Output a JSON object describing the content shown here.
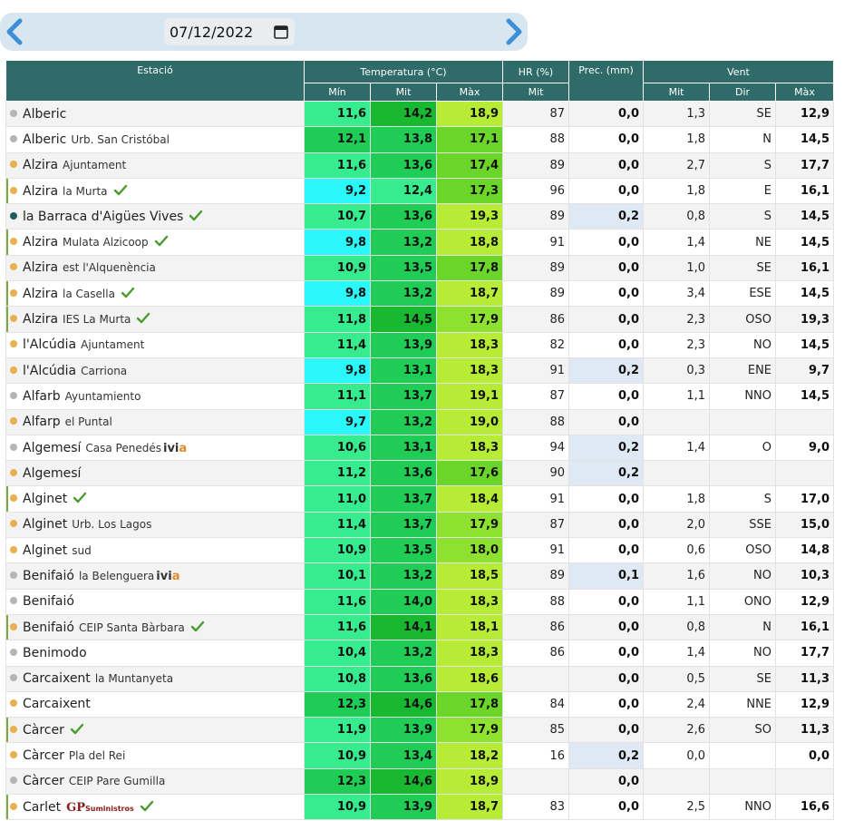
{
  "date": "07/12/2022",
  "headers": {
    "estacio": "Estació",
    "temperatura": "Temperatura (°C)",
    "hr": "HR (%)",
    "prec": "Prec. (mm)",
    "vent": "Vent",
    "min": "Mín",
    "mit": "Mit",
    "max": "Màx",
    "hr_mit": "Mit",
    "vent_mit": "Mit",
    "dir": "Dir",
    "vent_max": "Màx"
  },
  "colors": {
    "header_bg": "#2f6b68",
    "dot_grey": "#b5b5b5",
    "dot_orange": "#e8b04e",
    "dot_teal": "#1f5e5c",
    "check_green": "#4a9a2e",
    "cyan": "#2af7f7",
    "green_light": "#36ec8e",
    "green_mid": "#1fcc55",
    "green_dark": "#19b831",
    "lime": "#b6ec35",
    "lime2": "#8ee031",
    "lime3": "#6cd529"
  },
  "rows": [
    {
      "name": "Alberic",
      "sub": "",
      "dot": "grey",
      "check": false,
      "mark": false,
      "min": "11,6",
      "mit": "14,2",
      "max": "18,9",
      "hr": "87",
      "prec": "0,0",
      "wet": false,
      "vmit": "1,3",
      "dir": "SE",
      "vmax": "12,9",
      "cmin": "green_light",
      "cmit": "green_dark",
      "cmax": "lime"
    },
    {
      "name": "Alberic",
      "sub": "Urb. San Cristóbal",
      "dot": "grey",
      "check": false,
      "mark": false,
      "min": "12,1",
      "mit": "13,8",
      "max": "17,1",
      "hr": "88",
      "prec": "0,0",
      "wet": false,
      "vmit": "1,8",
      "dir": "N",
      "vmax": "14,5",
      "cmin": "green_mid",
      "cmit": "green_mid",
      "cmax": "lime3"
    },
    {
      "name": "Alzira",
      "sub": "Ajuntament",
      "dot": "orange",
      "check": false,
      "mark": false,
      "min": "11,6",
      "mit": "13,6",
      "max": "17,4",
      "hr": "89",
      "prec": "0,0",
      "wet": false,
      "vmit": "2,7",
      "dir": "S",
      "vmax": "17,7",
      "cmin": "green_light",
      "cmit": "green_mid",
      "cmax": "lime3"
    },
    {
      "name": "Alzira",
      "sub": "la Murta",
      "dot": "orange",
      "check": true,
      "mark": true,
      "min": "9,2",
      "mit": "12,4",
      "max": "17,3",
      "hr": "96",
      "prec": "0,0",
      "wet": false,
      "vmit": "1,8",
      "dir": "E",
      "vmax": "16,1",
      "cmin": "cyan",
      "cmit": "green_light",
      "cmax": "lime3"
    },
    {
      "name": "la Barraca d'Aigües Vives",
      "sub": "",
      "dot": "teal",
      "check": true,
      "mark": false,
      "min": "10,7",
      "mit": "13,6",
      "max": "19,3",
      "hr": "89",
      "prec": "0,2",
      "wet": true,
      "vmit": "0,8",
      "dir": "S",
      "vmax": "14,5",
      "cmin": "green_light",
      "cmit": "green_mid",
      "cmax": "lime"
    },
    {
      "name": "Alzira",
      "sub": "Mulata Alzicoop",
      "dot": "orange",
      "check": true,
      "mark": true,
      "min": "9,8",
      "mit": "13,2",
      "max": "18,8",
      "hr": "91",
      "prec": "0,0",
      "wet": false,
      "vmit": "1,4",
      "dir": "NE",
      "vmax": "14,5",
      "cmin": "cyan",
      "cmit": "green_mid",
      "cmax": "lime"
    },
    {
      "name": "Alzira",
      "sub": "est l'Alquenència",
      "dot": "orange",
      "check": false,
      "mark": false,
      "min": "10,9",
      "mit": "13,5",
      "max": "17,8",
      "hr": "89",
      "prec": "0,0",
      "wet": false,
      "vmit": "1,0",
      "dir": "SE",
      "vmax": "16,1",
      "cmin": "green_light",
      "cmit": "green_mid",
      "cmax": "lime3"
    },
    {
      "name": "Alzira",
      "sub": "la Casella",
      "dot": "orange",
      "check": true,
      "mark": true,
      "min": "9,8",
      "mit": "13,2",
      "max": "18,7",
      "hr": "89",
      "prec": "0,0",
      "wet": false,
      "vmit": "3,4",
      "dir": "ESE",
      "vmax": "14,5",
      "cmin": "cyan",
      "cmit": "green_mid",
      "cmax": "lime"
    },
    {
      "name": "Alzira",
      "sub": "IES La Murta",
      "dot": "orange",
      "check": true,
      "mark": true,
      "min": "11,8",
      "mit": "14,5",
      "max": "17,9",
      "hr": "86",
      "prec": "0,0",
      "wet": false,
      "vmit": "2,3",
      "dir": "OSO",
      "vmax": "19,3",
      "cmin": "green_light",
      "cmit": "green_dark",
      "cmax": "lime2"
    },
    {
      "name": "l'Alcúdia",
      "sub": "Ajuntament",
      "dot": "orange",
      "check": false,
      "mark": false,
      "min": "11,4",
      "mit": "13,9",
      "max": "18,3",
      "hr": "82",
      "prec": "0,0",
      "wet": false,
      "vmit": "2,3",
      "dir": "NO",
      "vmax": "14,5",
      "cmin": "green_light",
      "cmit": "green_mid",
      "cmax": "lime"
    },
    {
      "name": "l'Alcúdia",
      "sub": "Carriona",
      "dot": "orange",
      "check": false,
      "mark": false,
      "min": "9,8",
      "mit": "13,1",
      "max": "18,3",
      "hr": "91",
      "prec": "0,2",
      "wet": true,
      "vmit": "0,3",
      "dir": "ENE",
      "vmax": "9,7",
      "cmin": "cyan",
      "cmit": "green_mid",
      "cmax": "lime"
    },
    {
      "name": "Alfarb",
      "sub": "Ayuntamiento",
      "dot": "grey",
      "check": false,
      "mark": false,
      "min": "11,1",
      "mit": "13,7",
      "max": "19,1",
      "hr": "87",
      "prec": "0,0",
      "wet": false,
      "vmit": "1,1",
      "dir": "NNO",
      "vmax": "14,5",
      "cmin": "green_light",
      "cmit": "green_mid",
      "cmax": "lime"
    },
    {
      "name": "Alfarp",
      "sub": "el Puntal",
      "dot": "orange",
      "check": false,
      "mark": false,
      "min": "9,7",
      "mit": "13,2",
      "max": "19,0",
      "hr": "88",
      "prec": "0,0",
      "wet": false,
      "vmit": "",
      "dir": "",
      "vmax": "",
      "cmin": "cyan",
      "cmit": "green_mid",
      "cmax": "lime"
    },
    {
      "name": "Algemesí",
      "sub": "Casa Penedés",
      "logo": "ivia",
      "dot": "grey",
      "check": false,
      "mark": false,
      "min": "10,6",
      "mit": "13,1",
      "max": "18,3",
      "hr": "94",
      "prec": "0,2",
      "wet": true,
      "vmit": "1,4",
      "dir": "O",
      "vmax": "9,0",
      "cmin": "green_light",
      "cmit": "green_mid",
      "cmax": "lime"
    },
    {
      "name": "Algemesí",
      "sub": "",
      "dot": "orange",
      "check": false,
      "mark": false,
      "min": "11,2",
      "mit": "13,6",
      "max": "17,6",
      "hr": "90",
      "prec": "0,2",
      "wet": true,
      "vmit": "",
      "dir": "",
      "vmax": "",
      "cmin": "green_light",
      "cmit": "green_mid",
      "cmax": "lime3"
    },
    {
      "name": "Alginet",
      "sub": "",
      "dot": "orange",
      "check": true,
      "mark": true,
      "min": "11,0",
      "mit": "13,7",
      "max": "18,4",
      "hr": "91",
      "prec": "0,0",
      "wet": false,
      "vmit": "1,8",
      "dir": "S",
      "vmax": "17,0",
      "cmin": "green_light",
      "cmit": "green_mid",
      "cmax": "lime"
    },
    {
      "name": "Alginet",
      "sub": "Urb. Los Lagos",
      "dot": "orange",
      "check": false,
      "mark": false,
      "min": "11,4",
      "mit": "13,7",
      "max": "17,9",
      "hr": "87",
      "prec": "0,0",
      "wet": false,
      "vmit": "2,0",
      "dir": "SSE",
      "vmax": "15,0",
      "cmin": "green_light",
      "cmit": "green_mid",
      "cmax": "lime2"
    },
    {
      "name": "Alginet",
      "sub": "sud",
      "dot": "orange",
      "check": false,
      "mark": false,
      "min": "10,9",
      "mit": "13,5",
      "max": "18,0",
      "hr": "91",
      "prec": "0,0",
      "wet": false,
      "vmit": "0,6",
      "dir": "OSO",
      "vmax": "14,8",
      "cmin": "green_light",
      "cmit": "green_mid",
      "cmax": "lime2"
    },
    {
      "name": "Benifaió",
      "sub": "la Belenguera",
      "logo": "ivia",
      "dot": "grey",
      "check": false,
      "mark": false,
      "min": "10,1",
      "mit": "13,2",
      "max": "18,5",
      "hr": "89",
      "prec": "0,1",
      "wet": true,
      "vmit": "1,6",
      "dir": "NO",
      "vmax": "10,3",
      "cmin": "green_light",
      "cmit": "green_mid",
      "cmax": "lime"
    },
    {
      "name": "Benifaió",
      "sub": "",
      "dot": "grey",
      "check": false,
      "mark": false,
      "min": "11,6",
      "mit": "14,0",
      "max": "18,3",
      "hr": "88",
      "prec": "0,0",
      "wet": false,
      "vmit": "1,1",
      "dir": "ONO",
      "vmax": "12,9",
      "cmin": "green_light",
      "cmit": "green_mid",
      "cmax": "lime"
    },
    {
      "name": "Benifaió",
      "sub": "CEIP Santa Bàrbara",
      "dot": "orange",
      "check": true,
      "mark": true,
      "min": "11,6",
      "mit": "14,1",
      "max": "18,1",
      "hr": "86",
      "prec": "0,0",
      "wet": false,
      "vmit": "0,8",
      "dir": "N",
      "vmax": "16,1",
      "cmin": "green_light",
      "cmit": "green_dark",
      "cmax": "lime"
    },
    {
      "name": "Benimodo",
      "sub": "",
      "dot": "grey",
      "check": false,
      "mark": false,
      "min": "10,4",
      "mit": "13,2",
      "max": "18,3",
      "hr": "86",
      "prec": "0,0",
      "wet": false,
      "vmit": "1,4",
      "dir": "NO",
      "vmax": "17,7",
      "cmin": "green_light",
      "cmit": "green_mid",
      "cmax": "lime"
    },
    {
      "name": "Carcaixent",
      "sub": "la Muntanyeta",
      "dot": "grey",
      "check": false,
      "mark": false,
      "min": "10,8",
      "mit": "13,6",
      "max": "18,6",
      "hr": "",
      "prec": "0,0",
      "wet": false,
      "vmit": "0,5",
      "dir": "SE",
      "vmax": "11,3",
      "cmin": "green_light",
      "cmit": "green_mid",
      "cmax": "lime"
    },
    {
      "name": "Carcaixent",
      "sub": "",
      "dot": "orange",
      "check": false,
      "mark": false,
      "min": "12,3",
      "mit": "14,6",
      "max": "17,8",
      "hr": "84",
      "prec": "0,0",
      "wet": false,
      "vmit": "2,4",
      "dir": "NNE",
      "vmax": "12,9",
      "cmin": "green_mid",
      "cmit": "green_dark",
      "cmax": "lime3"
    },
    {
      "name": "Càrcer",
      "sub": "",
      "dot": "orange",
      "check": true,
      "mark": true,
      "min": "11,9",
      "mit": "13,9",
      "max": "17,9",
      "hr": "85",
      "prec": "0,0",
      "wet": false,
      "vmit": "2,6",
      "dir": "SO",
      "vmax": "11,3",
      "cmin": "green_light",
      "cmit": "green_mid",
      "cmax": "lime2"
    },
    {
      "name": "Càrcer",
      "sub": "Pla del Rei",
      "dot": "orange",
      "check": false,
      "mark": false,
      "min": "10,9",
      "mit": "13,4",
      "max": "18,2",
      "hr": "16",
      "prec": "0,2",
      "wet": true,
      "vmit": "0,0",
      "dir": "",
      "vmax": "0,0",
      "cmin": "green_light",
      "cmit": "green_mid",
      "cmax": "lime"
    },
    {
      "name": "Càrcer",
      "sub": "CEIP Pare Gumilla",
      "dot": "grey",
      "check": false,
      "mark": false,
      "min": "12,3",
      "mit": "14,6",
      "max": "18,9",
      "hr": "",
      "prec": "0,0",
      "wet": false,
      "vmit": "",
      "dir": "",
      "vmax": "",
      "cmin": "green_mid",
      "cmit": "green_dark",
      "cmax": "lime"
    },
    {
      "name": "Carlet",
      "sub": "",
      "logo": "gp",
      "dot": "orange",
      "check": true,
      "mark": true,
      "min": "10,9",
      "mit": "13,9",
      "max": "18,7",
      "hr": "83",
      "prec": "0,0",
      "wet": false,
      "vmit": "2,5",
      "dir": "NNO",
      "vmax": "16,6",
      "cmin": "green_light",
      "cmit": "green_mid",
      "cmax": "lime"
    }
  ],
  "logos": {
    "ivia_a": "ivi",
    "ivia_b": "a",
    "gp_main": "GP",
    "gp_small": "Suministros"
  }
}
